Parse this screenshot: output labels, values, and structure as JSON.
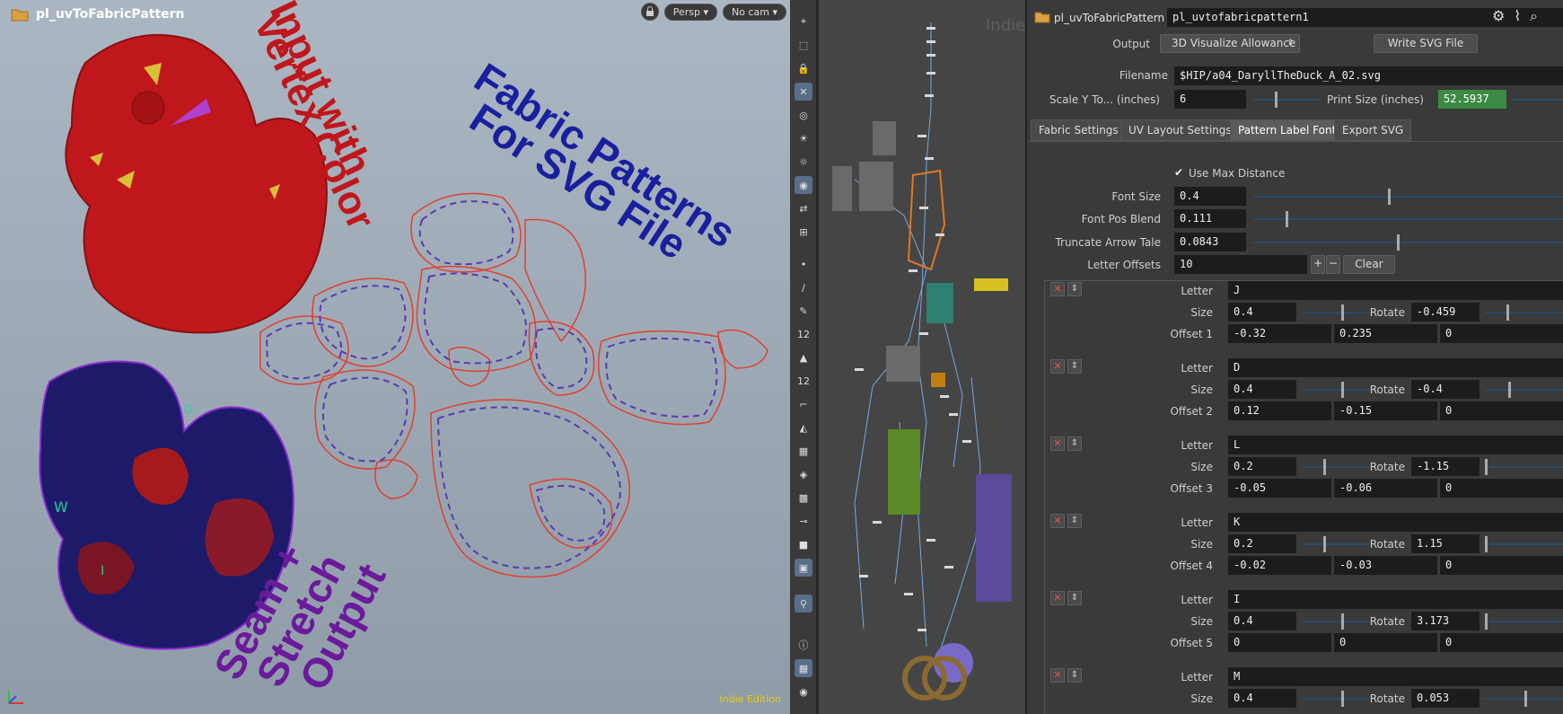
{
  "viewport": {
    "title": "pl_uvToFabricPattern",
    "persp_label": "Persp",
    "cam_label": "No cam",
    "indie_label": "Indie Edition",
    "annotations": {
      "input_line1": "Input with",
      "input_line2": "Vertex Color",
      "fabric_line1": "Fabric Patterns",
      "fabric_line2": "For SVG File",
      "seam_line1": "Seam +",
      "seam_line2": "Stretch",
      "seam_line3": "Output"
    },
    "colors": {
      "input": "#c0171c",
      "fabric": "#1a1f9e",
      "seam": "#6a1a9a"
    }
  },
  "network": {
    "indie_label": "Indie"
  },
  "params": {
    "node_type": "pl_uvToFabricPattern",
    "node_name": "pl_uvtofabricpattern1",
    "output_label": "Output",
    "output_value": "3D Visualize Allowance",
    "write_svg_label": "Write SVG File",
    "filename_label": "Filename",
    "filename_value": "$HIP/a04_DaryllTheDuck_A_02.svg",
    "scale_label": "Scale Y To... (inches)",
    "scale_value": "6",
    "print_size_label": "Print Size (inches)",
    "print_size_value": "52.5937",
    "tabs": [
      "Fabric Settings",
      "UV Layout Settings",
      "Pattern Label Font",
      "Export SVG"
    ],
    "use_max_label": "Use Max Distance",
    "font_size_label": "Font Size",
    "font_size_value": "0.4",
    "font_pos_label": "Font Pos Blend",
    "font_pos_value": "0.111",
    "truncate_label": "Truncate Arrow Tale",
    "truncate_value": "0.0843",
    "letter_offsets_label": "Letter Offsets",
    "letter_offsets_value": "10",
    "clear_label": "Clear",
    "letter_label": "Letter",
    "size_label": "Size",
    "rotate_label": "Rotate",
    "letters": [
      {
        "letter": "J",
        "size": "0.4",
        "rotate": "-0.459",
        "offset_label": "Offset 1",
        "ox": "-0.32",
        "oy": "0.235",
        "oz": "0"
      },
      {
        "letter": "D",
        "size": "0.4",
        "rotate": "-0.4",
        "offset_label": "Offset 2",
        "ox": "0.12",
        "oy": "-0.15",
        "oz": "0"
      },
      {
        "letter": "L",
        "size": "0.2",
        "rotate": "-1.15",
        "offset_label": "Offset 3",
        "ox": "-0.05",
        "oy": "-0.06",
        "oz": "0"
      },
      {
        "letter": "K",
        "size": "0.2",
        "rotate": "1.15",
        "offset_label": "Offset 4",
        "ox": "-0.02",
        "oy": "-0.03",
        "oz": "0"
      },
      {
        "letter": "I",
        "size": "0.4",
        "rotate": "3.173",
        "offset_label": "Offset 5",
        "ox": "0",
        "oy": "0",
        "oz": "0"
      },
      {
        "letter": "M",
        "size": "0.4",
        "rotate": "0.053"
      }
    ]
  }
}
